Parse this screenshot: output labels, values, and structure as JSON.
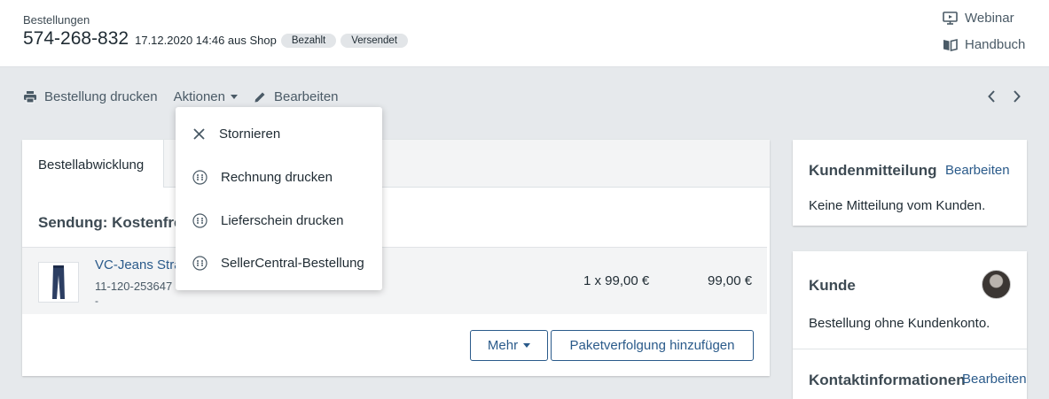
{
  "header": {
    "breadcrumb": "Bestellungen",
    "order_number": "574-268-832",
    "order_meta": "17.12.2020 14:46 aus Shop",
    "badges": [
      "Bezahlt",
      "Versendet"
    ],
    "webinar_label": "Webinar",
    "manual_label": "Handbuch"
  },
  "toolbar": {
    "print_label": "Bestellung drucken",
    "actions_label": "Aktionen",
    "edit_label": "Bearbeiten"
  },
  "dropdown": {
    "items": [
      {
        "label": "Stornieren",
        "icon": "close-icon"
      },
      {
        "label": "Rechnung drucken",
        "icon": "plugin-icon"
      },
      {
        "label": "Lieferschein drucken",
        "icon": "plugin-icon"
      },
      {
        "label": "SellerCentral-Bestellung",
        "icon": "plugin-icon"
      }
    ]
  },
  "main": {
    "tab_label": "Bestellabwicklung",
    "section_title": "Sendung: Kostenfre",
    "item": {
      "name": "VC-Jeans Stra",
      "sku": "11-120-253647",
      "variant": "-",
      "quantity_price": "1 x 99,00 €",
      "total": "99,00 €"
    },
    "more_button": "Mehr",
    "tracking_button": "Paketverfolgung hinzufügen"
  },
  "customer_message": {
    "title": "Kundenmitteilung",
    "edit_label": "Bearbeiten",
    "text": "Keine Mitteilung vom Kunden."
  },
  "customer": {
    "title": "Kunde",
    "text": "Bestellung ohne Kundenkonto.",
    "contact_title": "Kontaktinformationen",
    "contact_edit_label": "Bearbeiten"
  },
  "colors": {
    "accent": "#2a5a8a",
    "background": "#e6e9ec"
  }
}
